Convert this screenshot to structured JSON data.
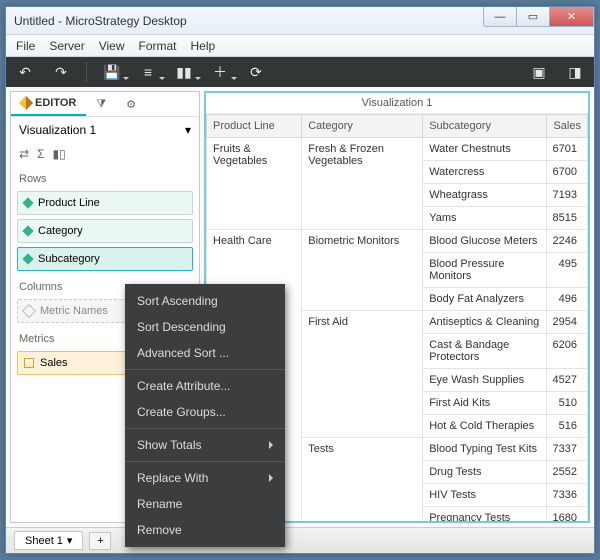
{
  "window": {
    "title": "Untitled - MicroStrategy Desktop"
  },
  "menubar": [
    "File",
    "Server",
    "View",
    "Format",
    "Help"
  ],
  "sidebar": {
    "editor_label": "EDITOR",
    "viz_name": "Visualization 1",
    "rows_label": "Rows",
    "columns_label": "Columns",
    "metrics_label": "Metrics",
    "rows": [
      "Product Line",
      "Category",
      "Subcategory"
    ],
    "columns_placeholder": "Metric Names",
    "metrics": [
      "Sales"
    ]
  },
  "viz": {
    "title": "Visualization 1",
    "headers": [
      "Product Line",
      "Category",
      "Subcategory",
      "Sales"
    ]
  },
  "context_menu": {
    "sort_asc": "Sort Ascending",
    "sort_desc": "Sort Descending",
    "adv_sort": "Advanced Sort ...",
    "create_attr": "Create Attribute...",
    "create_groups": "Create Groups...",
    "show_totals": "Show Totals",
    "replace_with": "Replace With",
    "rename": "Rename",
    "remove": "Remove"
  },
  "footer": {
    "sheet": "Sheet 1",
    "add": "+"
  },
  "chart_data": {
    "type": "table",
    "columns": [
      "Product Line",
      "Category",
      "Subcategory",
      "Sales"
    ],
    "rows": [
      {
        "product_line": "Fruits & Vegetables",
        "category": "Fresh & Frozen Vegetables",
        "subcategory": "Water Chestnuts",
        "sales": 6701
      },
      {
        "product_line": "Fruits & Vegetables",
        "category": "Fresh & Frozen Vegetables",
        "subcategory": "Watercress",
        "sales": 6700
      },
      {
        "product_line": "Fruits & Vegetables",
        "category": "Fresh & Frozen Vegetables",
        "subcategory": "Wheatgrass",
        "sales": 7193
      },
      {
        "product_line": "Fruits & Vegetables",
        "category": "Fresh & Frozen Vegetables",
        "subcategory": "Yams",
        "sales": 8515
      },
      {
        "product_line": "Health Care",
        "category": "Biometric Monitors",
        "subcategory": "Blood Glucose Meters",
        "sales": 2246
      },
      {
        "product_line": "Health Care",
        "category": "Biometric Monitors",
        "subcategory": "Blood Pressure Monitors",
        "sales": 495
      },
      {
        "product_line": "Health Care",
        "category": "Biometric Monitors",
        "subcategory": "Body Fat Analyzers",
        "sales": 496
      },
      {
        "product_line": "Health Care",
        "category": "First Aid",
        "subcategory": "Antiseptics & Cleaning",
        "sales": 2954
      },
      {
        "product_line": "Health Care",
        "category": "First Aid",
        "subcategory": "Cast & Bandage Protectors",
        "sales": 6206
      },
      {
        "product_line": "Health Care",
        "category": "First Aid",
        "subcategory": "Eye Wash Supplies",
        "sales": 4527
      },
      {
        "product_line": "Health Care",
        "category": "First Aid",
        "subcategory": "First Aid Kits",
        "sales": 510
      },
      {
        "product_line": "Health Care",
        "category": "First Aid",
        "subcategory": "Hot & Cold Therapies",
        "sales": 516
      },
      {
        "product_line": "Health Care",
        "category": "Tests",
        "subcategory": "Blood Typing Test Kits",
        "sales": 7337
      },
      {
        "product_line": "Health Care",
        "category": "Tests",
        "subcategory": "Drug Tests",
        "sales": 2552
      },
      {
        "product_line": "Health Care",
        "category": "Tests",
        "subcategory": "HIV Tests",
        "sales": 7336
      },
      {
        "product_line": "Health Care",
        "category": "Tests",
        "subcategory": "Pregnancy Tests",
        "sales": 1680
      }
    ]
  }
}
